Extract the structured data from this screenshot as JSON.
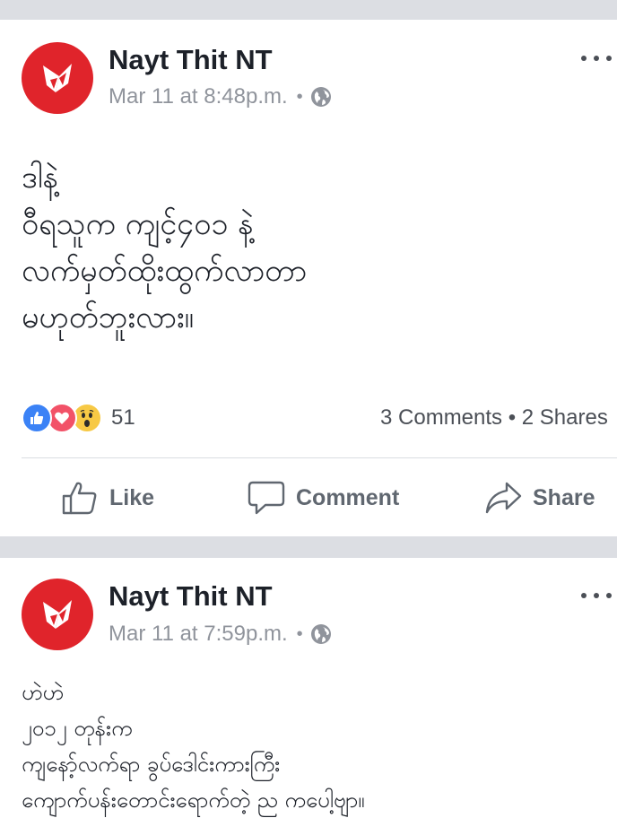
{
  "posts": [
    {
      "author": "Nayt Thit NT",
      "timestamp": "Mar 11 at 8:48p.m.",
      "separator": "•",
      "privacy_icon": "globe-icon",
      "body_lines": [
        "ဒါနဲ့",
        "ဝီရသူက ကျင့်၄၀၁ နဲ့",
        "လက်မှတ်ထိုးထွက်လာတာ",
        "မဟုတ်ဘူးလား။"
      ],
      "reaction_icons": [
        "like-icon",
        "love-icon",
        "wow-icon"
      ],
      "reaction_count": "51",
      "comments_shares": "3 Comments • 2 Shares",
      "actions": {
        "like": "Like",
        "comment": "Comment",
        "share": "Share"
      }
    },
    {
      "author": "Nayt Thit NT",
      "timestamp": "Mar 11 at 7:59p.m.",
      "separator": "•",
      "privacy_icon": "globe-icon",
      "body_lines": [
        "ဟဲဟဲ",
        "၂၀၁၂ တုန်းက",
        "ကျနော့်လက်ရာ ခွပ်ဒေါင်းကားကြီး",
        "ကျောက်ပန်းတောင်းရောက်တဲ့ ည ကပေါ့ဗျာ။"
      ]
    }
  ],
  "colors": {
    "brand_red": "#e0242b",
    "like_blue": "#3b82f6",
    "love_red": "#f25268",
    "wow_yellow": "#f7c945",
    "meta_gray": "#90949c",
    "page_bg": "#dcdee3"
  }
}
